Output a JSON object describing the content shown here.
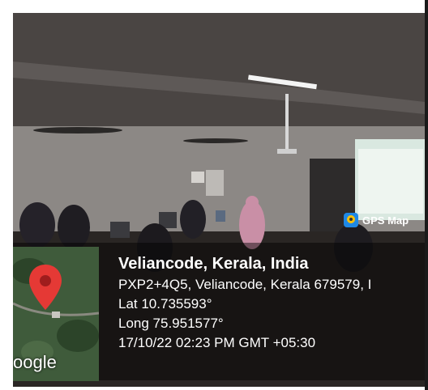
{
  "badge": {
    "label": "GPS Map",
    "icon": "gps-map-camera-icon"
  },
  "map": {
    "provider_label": "oogle",
    "icon": "map-pin-icon"
  },
  "location": {
    "place": "Veliancode, Kerala, India",
    "address": "PXP2+4Q5, Veliancode, Kerala 679579, I",
    "latitude": "Lat 10.735593°",
    "longitude": "Long 75.951577°",
    "timestamp": "17/10/22 02:23 PM GMT +05:30"
  },
  "colors": {
    "pin": "#e53935",
    "overlay": "#000000",
    "text": "#ffffff"
  }
}
